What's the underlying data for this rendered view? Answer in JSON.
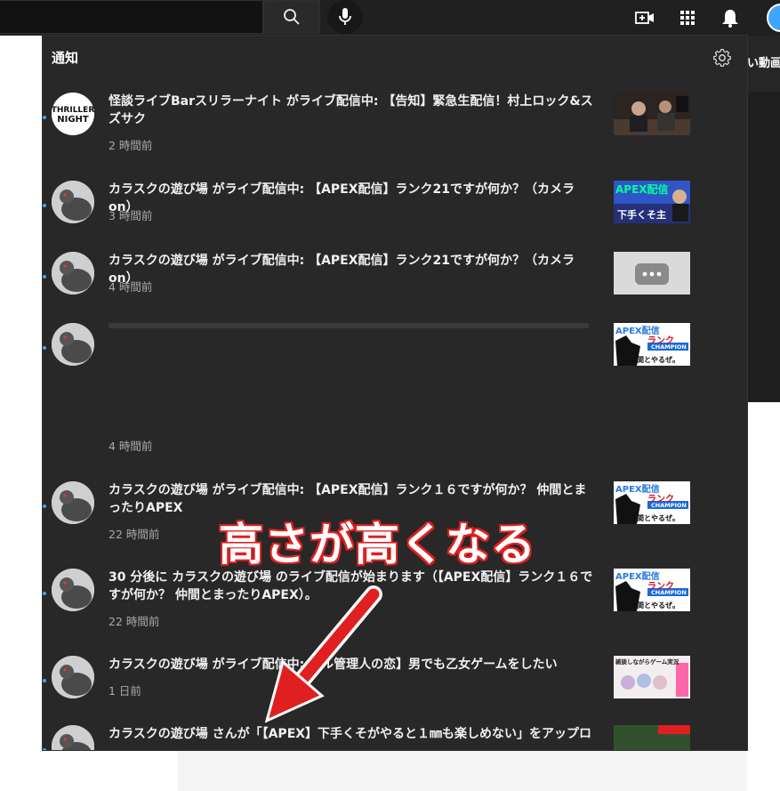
{
  "header": {
    "search_icon": "search-icon",
    "mic_icon": "mic-icon",
    "create_icon": "video-create-icon",
    "apps_icon": "apps-grid-icon",
    "bell_icon": "bell-icon"
  },
  "background": {
    "right_strip_text": "い動画の"
  },
  "panel": {
    "title": "通知",
    "settings_icon": "gear-icon"
  },
  "notifications": [
    {
      "text": "怪談ライブBarスリラーナイト がライブ配信中: 【告知】緊急生配信！村上ロック&スズサク",
      "time": "2 時間前",
      "avatar": "thriller-night-logo"
    },
    {
      "text": "カラスクの遊び場 がライブ配信中: 【APEX配信】ランク21ですが何か？（カメラon）",
      "time": "3 時間前",
      "avatar": "pigeon-avatar"
    },
    {
      "text": "カラスクの遊び場 がライブ配信中: 【APEX配信】ランク21ですが何か？（カメラon）",
      "time": "4 時間前",
      "avatar": "pigeon-avatar"
    },
    {
      "text": "",
      "time": "4 時間前",
      "avatar": "pigeon-avatar"
    },
    {
      "text": "カラスクの遊び場 がライブ配信中: 【APEX配信】ランク１６ですが何か？ 仲間とまったりAPEX",
      "time": "22 時間前",
      "avatar": "pigeon-avatar"
    },
    {
      "text": "30 分後に カラスクの遊び場 のライブ配信が始まります（【APEX配信】ランク１６ですが何か？ 仲間とまったりAPEX）。",
      "time": "22 時間前",
      "avatar": "pigeon-avatar"
    },
    {
      "text": "カラスクの遊び場 がライブ配信中: 【ル管理人の恋】男でも乙女ゲームをしたい",
      "time": "1 日前",
      "avatar": "pigeon-avatar"
    },
    {
      "text": "カラスクの遊び場 さんが「【APEX】下手くそがやると１㎜も楽しめない」をアップロ",
      "time": "",
      "avatar": "pigeon-avatar"
    }
  ],
  "thumbnails": {
    "t1": "live-studio-thumbnail",
    "t2_top": "APEX配信",
    "t2_bottom": "下手くそ主",
    "t4_top": "APEX配信",
    "t4_rank": "ランク",
    "t4_champ": "CHAMPION",
    "t4_bottom": "仲間とやるぜ。",
    "t7_top": "雑談しながらゲーム実況"
  },
  "annotation": {
    "text": "高さが高くなる"
  },
  "colors": {
    "panel_bg": "#282828",
    "topbar_bg": "#202020",
    "accent_blue": "#3ea6ff",
    "annotation_red": "#e02020"
  }
}
